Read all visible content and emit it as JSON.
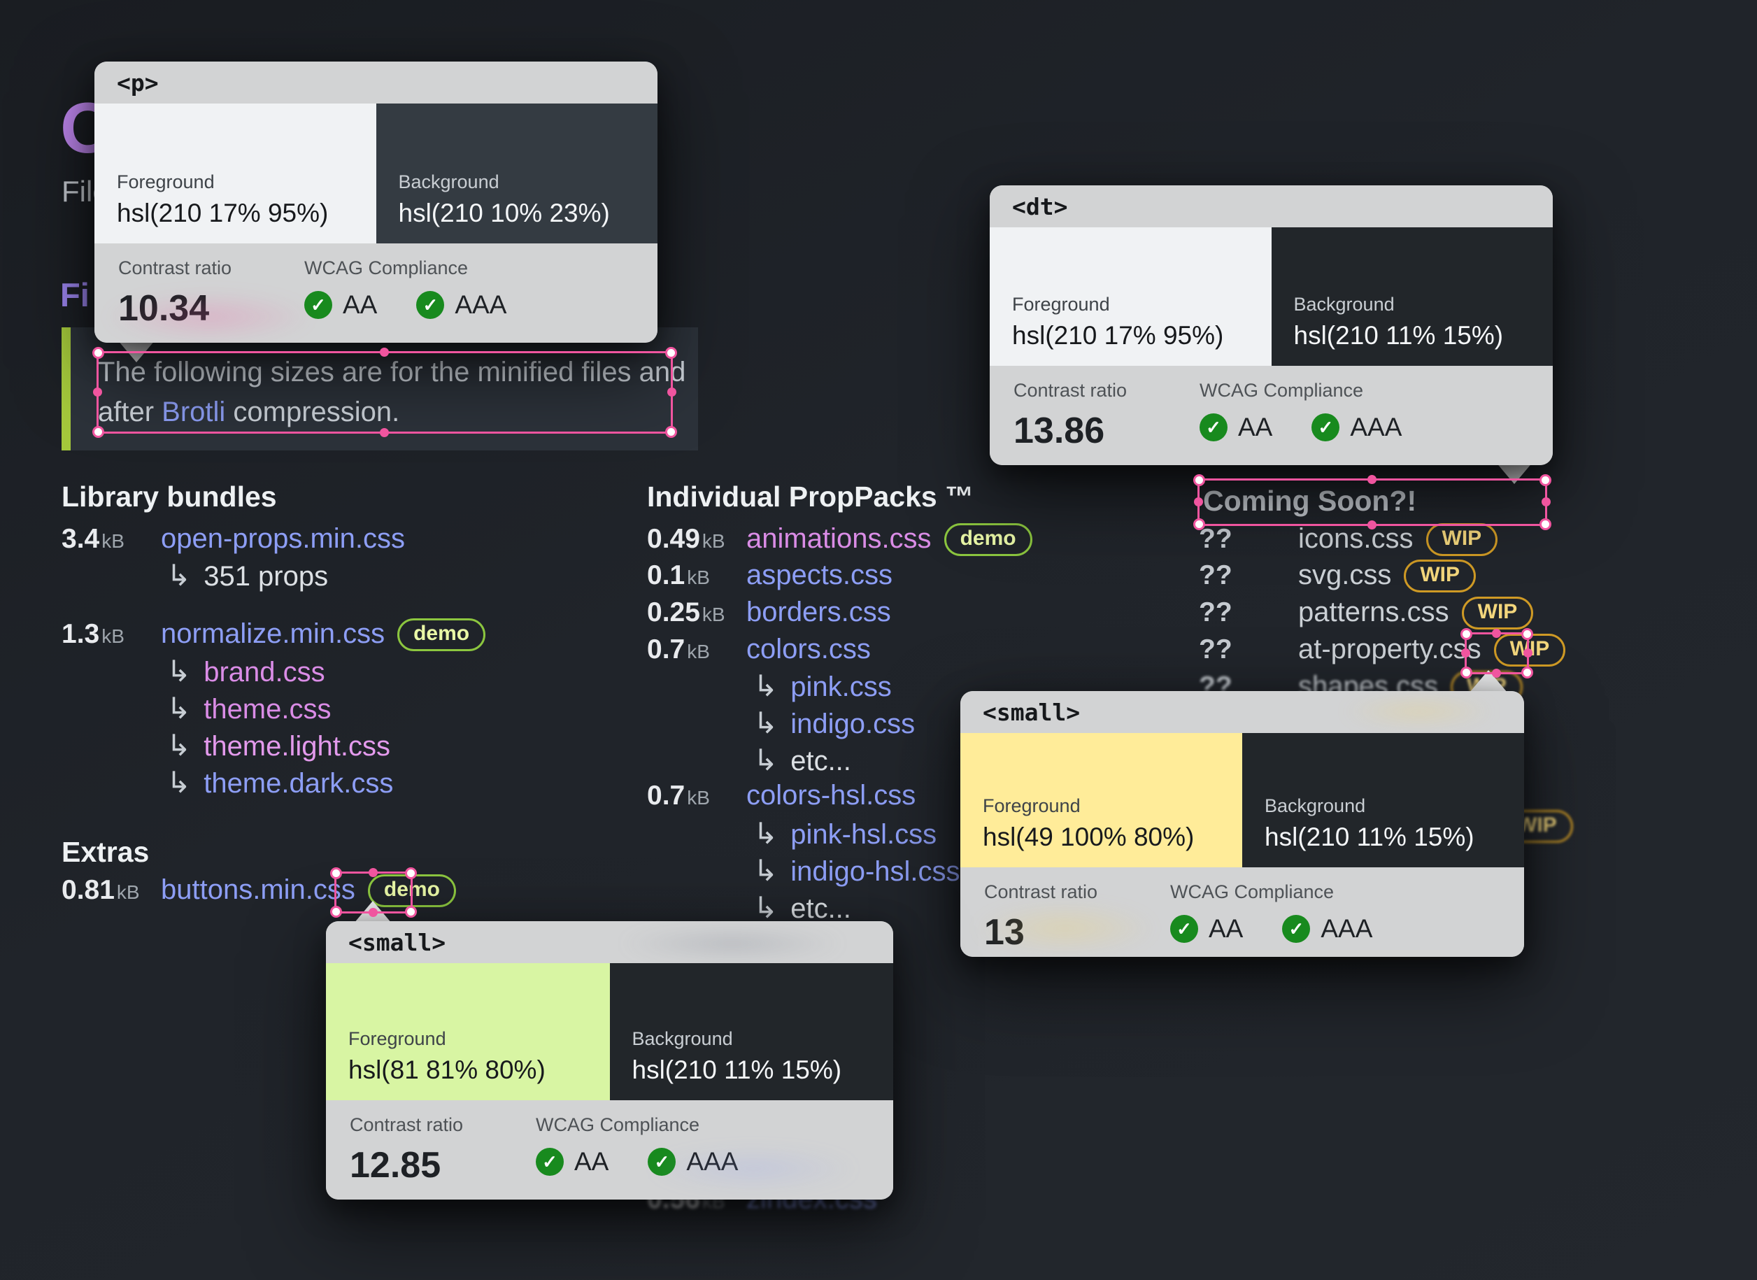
{
  "colors": {
    "page_bg": "#22262B",
    "panel_bg": "#2C323A",
    "accent_bar": "#A5C93C",
    "hero_violet": "#BD85EC",
    "heading_indigo": "#9C85EF",
    "link_blue": "#8D9EF5",
    "link_pink": "#DA8CE6",
    "link_pink_light": "#E39AEC",
    "demo_border": "#8CC63F",
    "demo_text": "#E9F7A6",
    "wip_border": "#CF9A25",
    "wip_text": "#F3D67C",
    "selection_pink": "#F0559F",
    "card_gray": "#D2D3D4",
    "check_green": "#188A1E"
  },
  "icons": {
    "branch_arrow": "↳",
    "check": "✓"
  },
  "hero": {
    "big_letter": "O",
    "file_label": "File",
    "heading_partial": "Fi"
  },
  "note": {
    "line1": "The following sizes are for the minified files and",
    "line2_pre": "after ",
    "link": "Brotli",
    "line2_post": " compression."
  },
  "library": {
    "title": "Library bundles",
    "rows": [
      {
        "size": "3.4",
        "unit": "kB",
        "name": "open-props.min.css",
        "tone": "blue"
      },
      {
        "size": "1.3",
        "unit": "kB",
        "name": "normalize.min.css",
        "tone": "blue",
        "badge": "demo"
      }
    ],
    "subs0": [
      {
        "text": "351 props",
        "tone": "plain"
      }
    ],
    "subs1": [
      {
        "text": "brand.css",
        "tone": "pink"
      },
      {
        "text": "theme.css",
        "tone": "pink"
      },
      {
        "text": "theme.light.css",
        "tone": "pink2"
      },
      {
        "text": "theme.dark.css",
        "tone": "blue"
      }
    ]
  },
  "extras": {
    "title": "Extras",
    "rows": [
      {
        "size": "0.81",
        "unit": "kB",
        "name": "buttons.min.css",
        "tone": "blue",
        "badge": "demo"
      }
    ]
  },
  "proppacks": {
    "title": "Individual PropPacks ™",
    "rows": [
      {
        "kind": "file",
        "size": "0.49",
        "unit": "kB",
        "name": "animations.css",
        "tone": "pink",
        "badge": "demo"
      },
      {
        "kind": "file",
        "size": "0.1",
        "unit": "kB",
        "name": "aspects.css",
        "tone": "blue"
      },
      {
        "kind": "file",
        "size": "0.25",
        "unit": "kB",
        "name": "borders.css",
        "tone": "blue"
      },
      {
        "kind": "file",
        "size": "0.7",
        "unit": "kB",
        "name": "colors.css",
        "tone": "blue"
      },
      {
        "kind": "sub",
        "text": "pink.css",
        "tone": "blue"
      },
      {
        "kind": "sub",
        "text": "indigo.css",
        "tone": "blue"
      },
      {
        "kind": "sub",
        "text": "etc...",
        "tone": "plain"
      },
      {
        "kind": "file",
        "size": "0.7",
        "unit": "kB",
        "name": "colors-hsl.css",
        "tone": "blue"
      },
      {
        "kind": "sub",
        "text": "pink-hsl.css",
        "tone": "blue"
      },
      {
        "kind": "sub",
        "text": "indigo-hsl.css",
        "tone": "blue"
      },
      {
        "kind": "sub",
        "text": "etc...",
        "tone": "plain"
      }
    ]
  },
  "coming": {
    "title": "Coming Soon?!",
    "rows": [
      {
        "size": "??",
        "name": "icons.css",
        "badge": "WIP",
        "tone": "gray"
      },
      {
        "size": "??",
        "name": "svg.css",
        "badge": "WIP",
        "tone": "gray"
      },
      {
        "size": "??",
        "name": "patterns.css",
        "badge": "WIP",
        "tone": "gray"
      },
      {
        "size": "??",
        "name": "at-property.css",
        "badge": "WIP",
        "tone": "gray"
      },
      {
        "size": "??",
        "name": "shapes.css",
        "badge": "WIP",
        "tone": "gray"
      }
    ]
  },
  "ghost": {
    "size": "0.56",
    "unit": "kB",
    "name": "zindex.css",
    "tone": "blue",
    "partial_badge": "WIP"
  },
  "cards": [
    {
      "tag": "<p>",
      "fg_label": "Foreground",
      "fg_value": "hsl(210 17% 95%)",
      "fg_hex": "#F0F2F4",
      "bg_label": "Background",
      "bg_value": "hsl(210 10% 23%)",
      "bg_hex": "#343B42",
      "ratio_label": "Contrast ratio",
      "ratio": "10.34",
      "wcag_label": "WCAG Compliance",
      "aa": "AA",
      "aaa": "AAA"
    },
    {
      "tag": "<dt>",
      "fg_label": "Foreground",
      "fg_value": "hsl(210 17% 95%)",
      "fg_hex": "#F0F2F4",
      "bg_label": "Background",
      "bg_value": "hsl(210 11% 15%)",
      "bg_hex": "#22262A",
      "ratio_label": "Contrast ratio",
      "ratio": "13.86",
      "wcag_label": "WCAG Compliance",
      "aa": "AA",
      "aaa": "AAA"
    },
    {
      "tag": "<small>",
      "fg_label": "Foreground",
      "fg_value": "hsl(49 100% 80%)",
      "fg_hex": "#FFEC99",
      "bg_label": "Background",
      "bg_value": "hsl(210 11% 15%)",
      "bg_hex": "#22262A",
      "ratio_label": "Contrast ratio",
      "ratio": "13",
      "wcag_label": "WCAG Compliance",
      "aa": "AA",
      "aaa": "AAA"
    },
    {
      "tag": "<small>",
      "fg_label": "Foreground",
      "fg_value": "hsl(81 81% 80%)",
      "fg_hex": "#D8F5A3",
      "bg_label": "Background",
      "bg_value": "hsl(210 11% 15%)",
      "bg_hex": "#22262A",
      "ratio_label": "Contrast ratio",
      "ratio": "12.85",
      "wcag_label": "WCAG Compliance",
      "aa": "AA",
      "aaa": "AAA"
    }
  ]
}
